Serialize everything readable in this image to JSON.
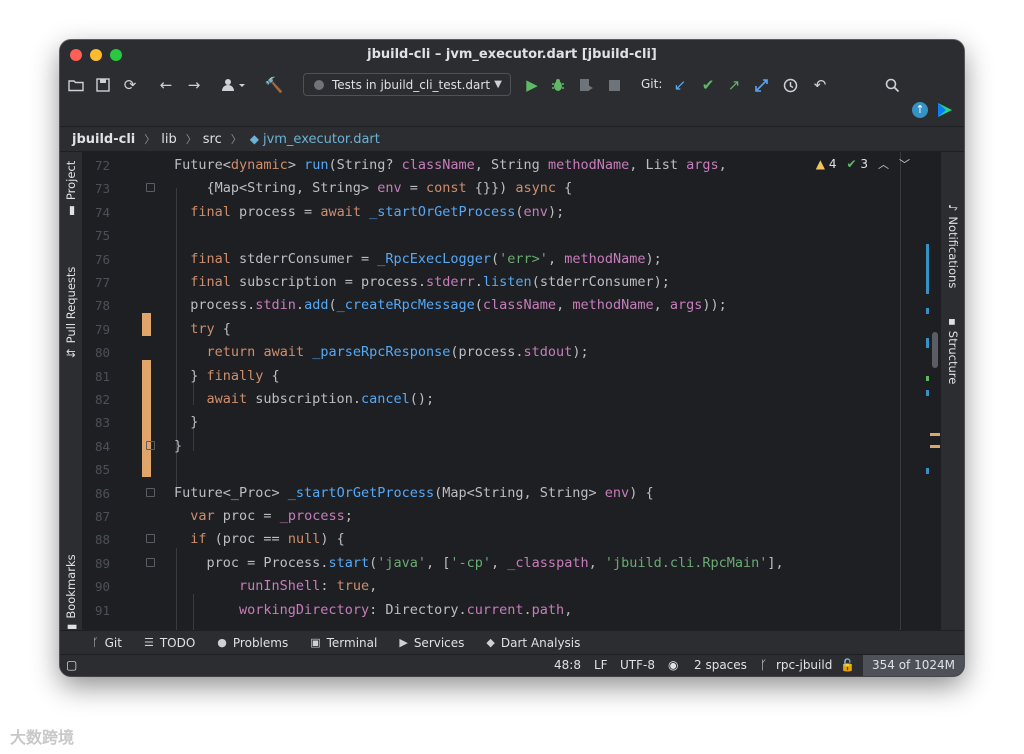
{
  "window": {
    "title": "jbuild-cli – jvm_executor.dart [jbuild-cli]"
  },
  "toolbar": {
    "run_config": "Tests in jbuild_cli_test.dart",
    "git_label": "Git:"
  },
  "breadcrumb": {
    "items": [
      "jbuild-cli",
      "lib",
      "src",
      "jvm_executor.dart"
    ]
  },
  "side_tabs": {
    "left": [
      "Project",
      "Pull Requests",
      "Bookmarks"
    ],
    "right": [
      "Notifications",
      "Structure"
    ]
  },
  "inspections": {
    "warnings": "4",
    "ok": "3"
  },
  "editor": {
    "lines": [
      {
        "n": "72",
        "code": "Future<dynamic> run(String? className, String methodName, List args,"
      },
      {
        "n": "73",
        "code": "    {Map<String, String> env = const {}}) async {"
      },
      {
        "n": "74",
        "code": "  final process = await _startOrGetProcess(env);"
      },
      {
        "n": "75",
        "code": ""
      },
      {
        "n": "76",
        "code": "  final stderrConsumer = _RpcExecLogger('err>', methodName);"
      },
      {
        "n": "77",
        "code": "  final subscription = process.stderr.listen(stderrConsumer);"
      },
      {
        "n": "78",
        "code": "  process.stdin.add(_createRpcMessage(className, methodName, args));"
      },
      {
        "n": "79",
        "code": "  try {"
      },
      {
        "n": "80",
        "code": "    return await _parseRpcResponse(process.stdout);"
      },
      {
        "n": "81",
        "code": "  } finally {"
      },
      {
        "n": "82",
        "code": "    await subscription.cancel();"
      },
      {
        "n": "83",
        "code": "  }"
      },
      {
        "n": "84",
        "code": "}"
      },
      {
        "n": "85",
        "code": ""
      },
      {
        "n": "86",
        "code": "Future<_Proc> _startOrGetProcess(Map<String, String> env) {"
      },
      {
        "n": "87",
        "code": "  var proc = _process;"
      },
      {
        "n": "88",
        "code": "  if (proc == null) {"
      },
      {
        "n": "89",
        "code": "    proc = Process.start('java', ['-cp', _classpath, 'jbuild.cli.RpcMain'],"
      },
      {
        "n": "90",
        "code": "        runInShell: true,"
      },
      {
        "n": "91",
        "code": "        workingDirectory: Directory.current.path,"
      }
    ]
  },
  "tool_windows": [
    "Git",
    "TODO",
    "Problems",
    "Terminal",
    "Services",
    "Dart Analysis"
  ],
  "status": {
    "position": "48:8",
    "line_sep": "LF",
    "encoding": "UTF-8",
    "indent": "2 spaces",
    "branch": "rpc-jbuild",
    "memory": "354 of 1024M"
  },
  "watermark": "大数跨境",
  "colors": {
    "keyword": "#cf8e6d",
    "function": "#56a8f5",
    "string": "#6aab73",
    "field": "#c77dbb",
    "change_marker": "#e0a56b",
    "background": "#1e1f22",
    "panel": "#2b2d30"
  }
}
